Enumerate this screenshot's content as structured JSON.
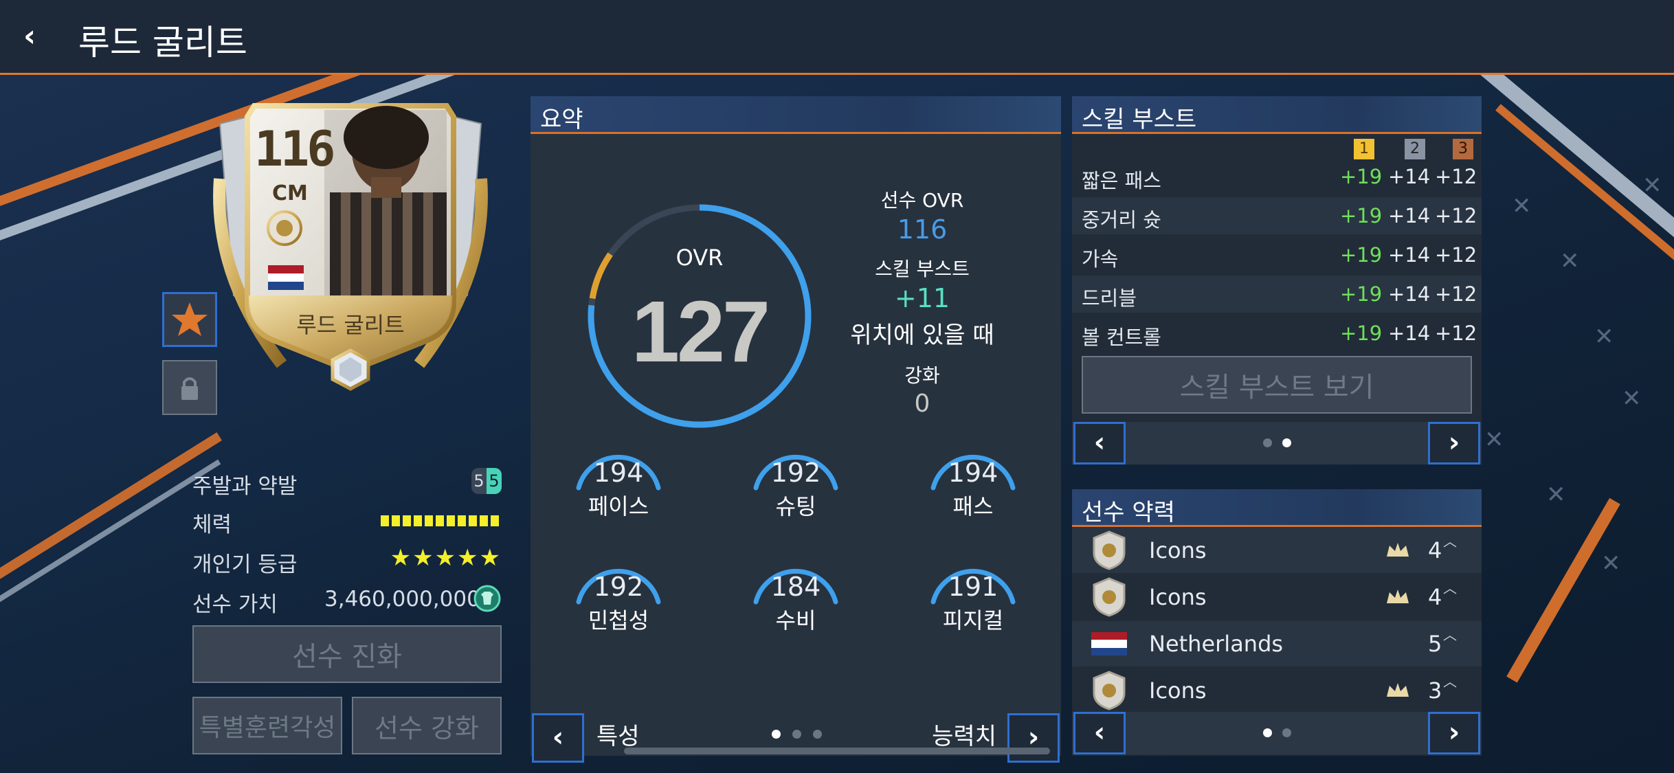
{
  "header": {
    "back_glyph": "‹",
    "title": "루드 굴리트"
  },
  "card": {
    "rating": "116",
    "position": "CM",
    "name": "루드 굴리트",
    "country_flag": "netherlands-flag-icon"
  },
  "left_stats": {
    "foot_label": "주발과 약발",
    "foot_left": "5",
    "foot_right": "5",
    "stamina_label": "체력",
    "stamina_fraction": 1.0,
    "popularity_label": "개인기 등급",
    "popularity_stars": 5,
    "stars_text": "★★★★★",
    "value_label": "선수 가치",
    "value": "3,460,000,000"
  },
  "buttons": {
    "evolve": "선수 진화",
    "special_training": "특별훈련각성",
    "enhance": "선수 강화"
  },
  "summary": {
    "title": "요약",
    "ovr_label": "OVR",
    "ovr_value": "127",
    "player_ovr_label": "선수 OVR",
    "player_ovr_value": "116",
    "skill_boost_label": "스킬 부스트",
    "skill_boost_value": "+11",
    "position_text": "위치에 있을 때",
    "enhance_label": "강화",
    "enhance_value": "0",
    "gauges": [
      {
        "label": "페이스",
        "value": "194"
      },
      {
        "label": "슈팅",
        "value": "192"
      },
      {
        "label": "패스",
        "value": "194"
      },
      {
        "label": "민첩성",
        "value": "192"
      },
      {
        "label": "수비",
        "value": "184"
      },
      {
        "label": "피지컬",
        "value": "191"
      }
    ],
    "nav_left_label": "특성",
    "nav_right_label": "능력치",
    "prev_glyph": "‹",
    "next_glyph": "›"
  },
  "skill_boost": {
    "title": "스킬 부스트",
    "levels": [
      "1",
      "2",
      "3"
    ],
    "rows": [
      {
        "name": "짧은 패스",
        "v1": "+19",
        "v2": "+14",
        "v3": "+12"
      },
      {
        "name": "중거리 슛",
        "v1": "+19",
        "v2": "+14",
        "v3": "+12"
      },
      {
        "name": "가속",
        "v1": "+19",
        "v2": "+14",
        "v3": "+12"
      },
      {
        "name": "드리블",
        "v1": "+19",
        "v2": "+14",
        "v3": "+12"
      },
      {
        "name": "볼 컨트롤",
        "v1": "+19",
        "v2": "+14",
        "v3": "+12"
      }
    ],
    "view_button": "스킬 부스트 보기"
  },
  "chemistry": {
    "title": "선수 약력",
    "rows": [
      {
        "icon": "icons-badge-icon",
        "name": "Icons",
        "count": "4"
      },
      {
        "icon": "icons-badge-icon",
        "name": "Icons",
        "count": "4"
      },
      {
        "icon": "netherlands-flag-icon",
        "name": "Netherlands",
        "count": "5"
      },
      {
        "icon": "icons-badge-icon",
        "name": "Icons",
        "count": "3"
      }
    ]
  },
  "colors": {
    "accent_orange": "#e0782e",
    "boost_green": "#6ee05a",
    "ovr_blue": "#4a9be6",
    "nav_blue": "#2f6fd1"
  }
}
